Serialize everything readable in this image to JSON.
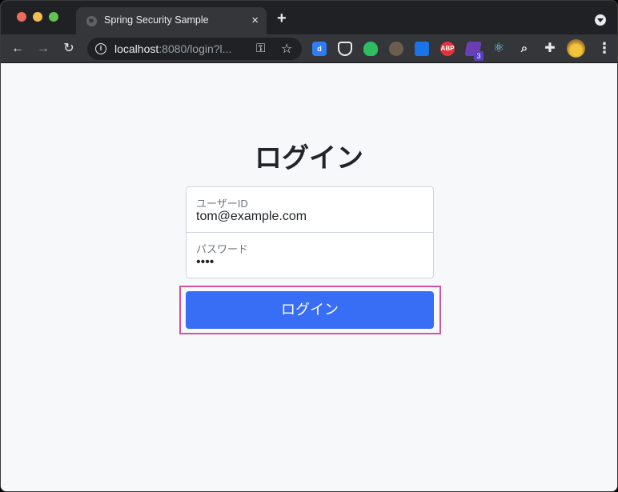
{
  "browser": {
    "tab": {
      "title": "Spring Security Sample",
      "close_icon": "×"
    },
    "new_tab_icon": "+",
    "url_host": "localhost",
    "url_rest": ":8080/login?l...",
    "icons": {
      "back": "←",
      "forward": "→",
      "reload": "↻",
      "info": "i",
      "key": "⚿",
      "star": "☆",
      "menu": "⋮",
      "react": "⚛",
      "zoom": "⌕",
      "puzzle": "✚"
    },
    "extensions": {
      "d_label": "d",
      "abp_label": "ABP",
      "badge_count": "3"
    }
  },
  "page": {
    "heading": "ログイン",
    "user_field": {
      "label": "ユーザーID",
      "value": "tom@example.com"
    },
    "password_field": {
      "label": "パスワード",
      "value": "••••"
    },
    "submit_label": "ログイン"
  },
  "colors": {
    "button": "#386df5",
    "highlight": "#d5539a",
    "background": "#f7f8fa"
  }
}
